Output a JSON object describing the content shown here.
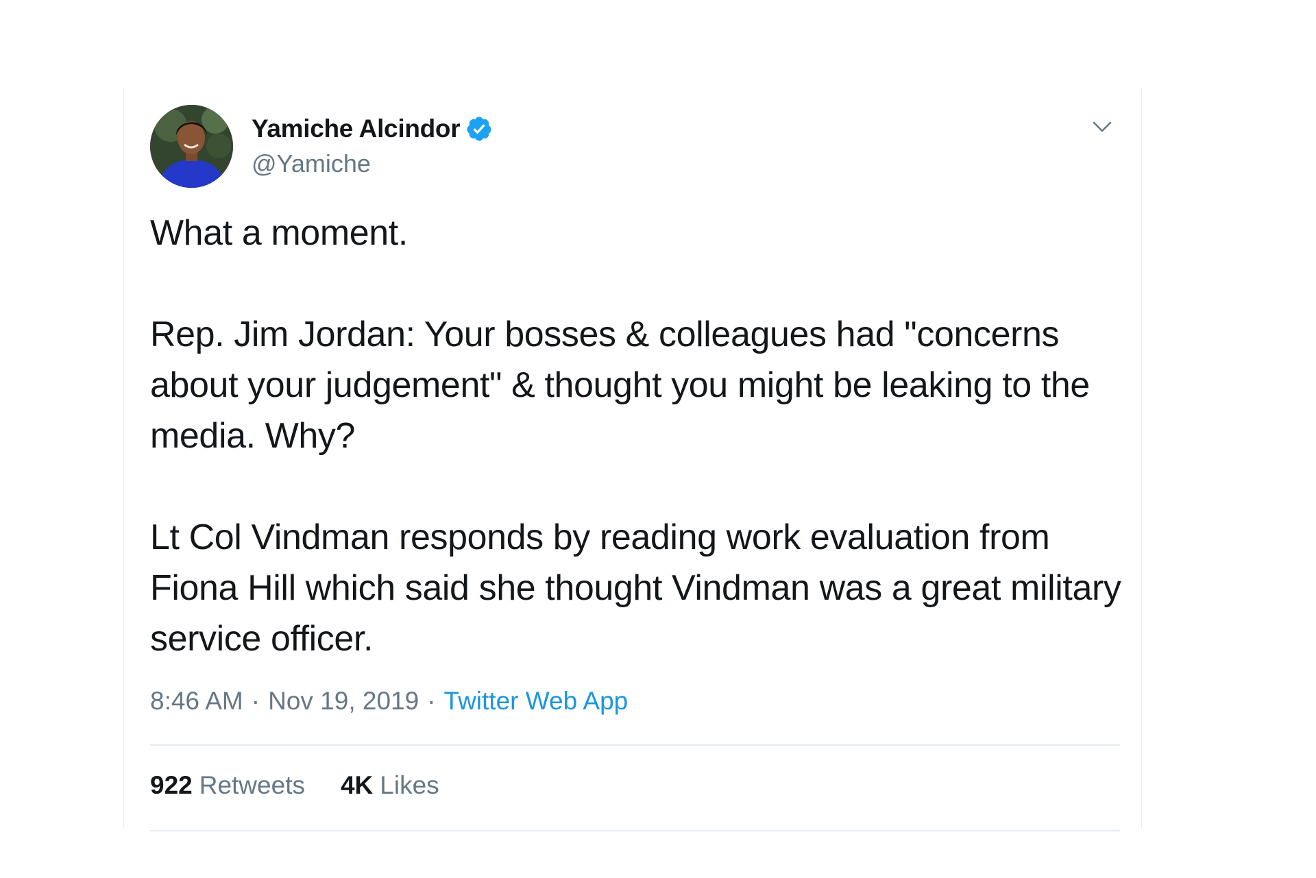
{
  "author": {
    "display_name": "Yamiche Alcindor",
    "handle": "@Yamiche",
    "verified": true
  },
  "tweet": {
    "paragraphs": [
      "What a moment.",
      "Rep. Jim Jordan: Your bosses & colleagues had \"concerns about your judgement\" & thought you might be leaking to the media. Why?",
      "Lt Col Vindman responds by reading work evaluation from Fiona Hill which said she thought Vindman was a great military service officer."
    ]
  },
  "meta": {
    "time": "8:46 AM",
    "separator": "·",
    "date": "Nov 19, 2019",
    "source": "Twitter Web App"
  },
  "stats": {
    "retweets_count": "922",
    "retweets_label": "Retweets",
    "likes_count": "4K",
    "likes_label": "Likes"
  },
  "colors": {
    "text_primary": "#14171a",
    "text_secondary": "#657786",
    "link": "#1b95e0",
    "verified_badge": "#1da1f2",
    "divider": "#e6ecf0"
  },
  "icons": {
    "verified": "verified-badge-icon",
    "caret": "chevron-down-icon"
  }
}
